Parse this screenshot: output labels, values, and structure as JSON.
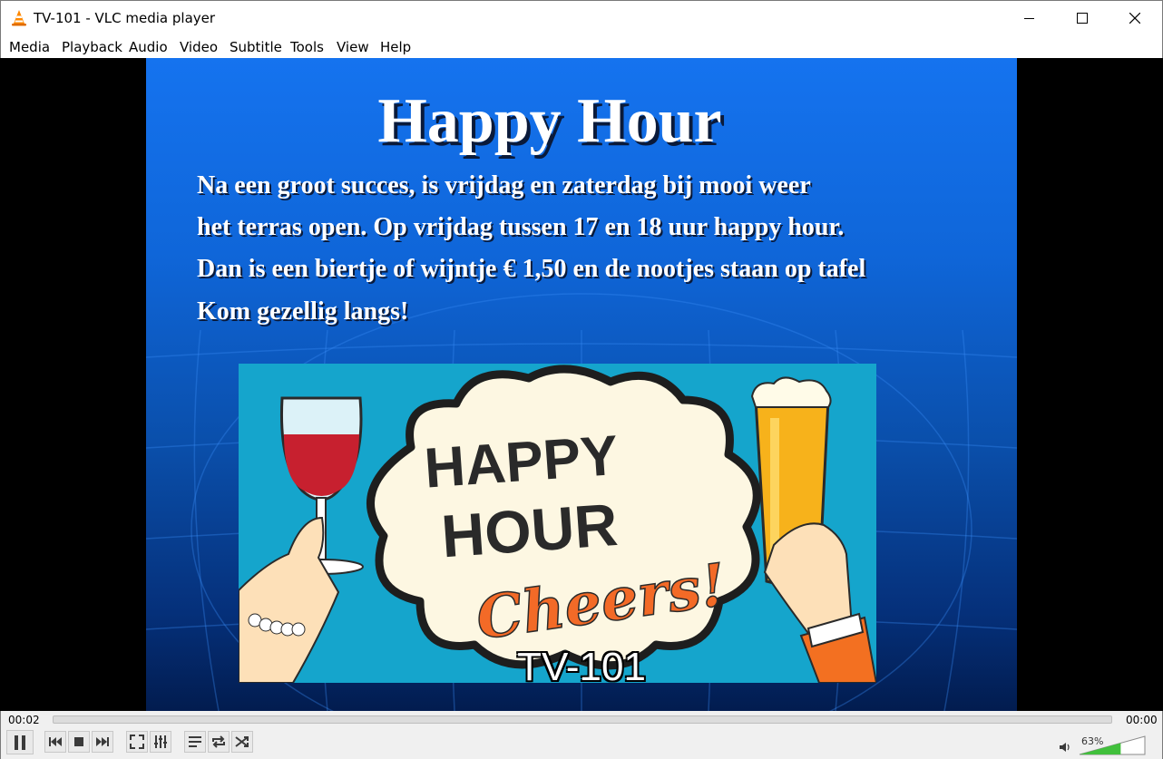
{
  "window": {
    "title": "TV-101 - VLC media player",
    "app_icon": "vlc-cone-icon"
  },
  "menu": [
    "Media",
    "Playback",
    "Audio",
    "Video",
    "Subtitle",
    "Tools",
    "View",
    "Help"
  ],
  "slide": {
    "title": "Happy Hour",
    "lines": [
      "Na een groot succes, is  vrijdag en zaterdag bij mooi weer",
      "het terras open. Op vrijdag tussen 17 en 18 uur happy hour.",
      "Dan is een biertje of wijntje €  1,50 en de nootjes staan op tafel",
      "Kom gezellig langs!"
    ],
    "picture": {
      "line1": "HAPPY",
      "line2": "HOUR",
      "line3": "Cheers!"
    },
    "subtitle": "TV-101"
  },
  "controls": {
    "time_elapsed": "00:02",
    "time_total": "00:00",
    "volume_label": "63%",
    "volume_level": 0.63,
    "buttons": [
      "pause-icon",
      "previous-icon",
      "stop-icon",
      "next-icon",
      "fullscreen-icon",
      "extended-settings-icon",
      "playlist-icon",
      "loop-icon",
      "shuffle-icon",
      "speaker-icon"
    ]
  },
  "colors": {
    "slide_blue": "#1573ef",
    "picture_bg": "#15a5cc",
    "volume_green": "#41c03c"
  }
}
